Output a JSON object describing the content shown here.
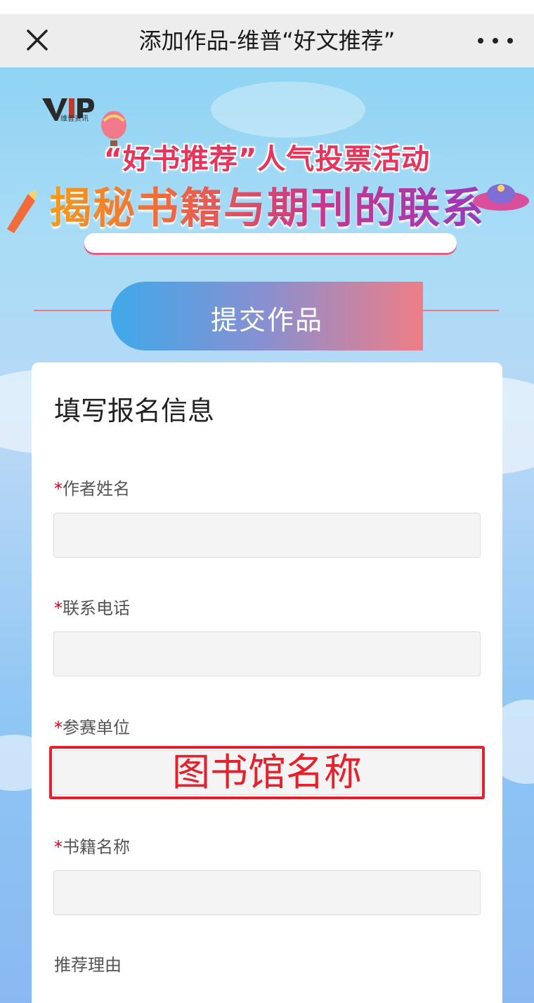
{
  "titlebar": {
    "title": "添加作品-维普“好文推荐”",
    "close_icon": "close-icon",
    "more_icon": "more-dots-icon"
  },
  "banner": {
    "logo_text": "维普资讯",
    "headline_1": "“好书推荐”人气投票活动",
    "headline_2": "揭秘书籍与期刊的联系"
  },
  "submit_section": {
    "label": "提交作品"
  },
  "form": {
    "title": "填写报名信息",
    "required_mark": "*",
    "fields": [
      {
        "label": "作者姓名",
        "required": true,
        "value": ""
      },
      {
        "label": "联系电话",
        "required": true,
        "value": ""
      },
      {
        "label": "参赛单位",
        "required": true,
        "value": ""
      },
      {
        "label": "书籍名称",
        "required": true,
        "value": ""
      },
      {
        "label": "推荐理由",
        "required": false,
        "value": ""
      }
    ]
  },
  "annotation": {
    "text": "图书馆名称",
    "color": "#e5202a"
  },
  "colors": {
    "accent_red": "#d0021b",
    "banner_gradient_start": "#3fa9ea",
    "banner_gradient_end": "#ef7d86"
  }
}
